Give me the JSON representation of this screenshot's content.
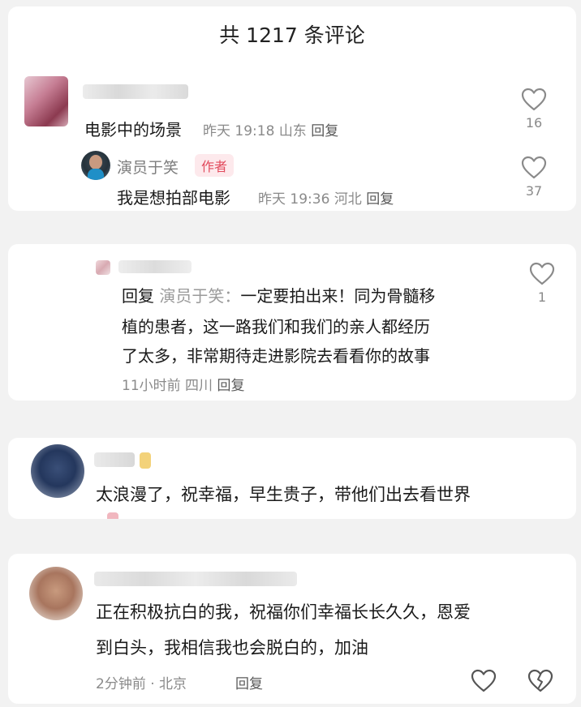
{
  "header": {
    "title": "共 1217 条评论"
  },
  "comments": [
    {
      "text": "电影中的场景",
      "time": "昨天 19:18",
      "location": "山东",
      "reply_label": "回复",
      "likes": "16",
      "reply": {
        "name": "演员于笑",
        "tag": "作者",
        "text": "我是想拍部电影",
        "time": "昨天 19:36",
        "location": "河北",
        "reply_label": "回复",
        "likes": "37"
      }
    },
    {
      "reply_prefix": "回复",
      "reply_to": "演员于笑：",
      "line1": "一定要拍出来！同为骨髓移",
      "line2": "植的患者，这一路我们和我们的亲人都经历",
      "line3": "了太多，非常期待走进影院去看看你的故事",
      "time": "11小时前",
      "location": "四川",
      "reply_label": "回复",
      "likes": "1"
    },
    {
      "text": "太浪漫了，祝幸福，早生贵子，带他们出去看世界"
    },
    {
      "line1": "正在积极抗白的我，祝福你们幸福长长久久，恩爱",
      "line2": "到白头，我相信我也会脱白的，加油",
      "time_location": "2分钟前 · 北京",
      "reply_label": "回复"
    }
  ],
  "colors": {
    "accent": "#e24b5d",
    "meta": "#8a8a8a"
  },
  "icons": [
    "heart-outline-icon",
    "broken-heart-icon"
  ]
}
